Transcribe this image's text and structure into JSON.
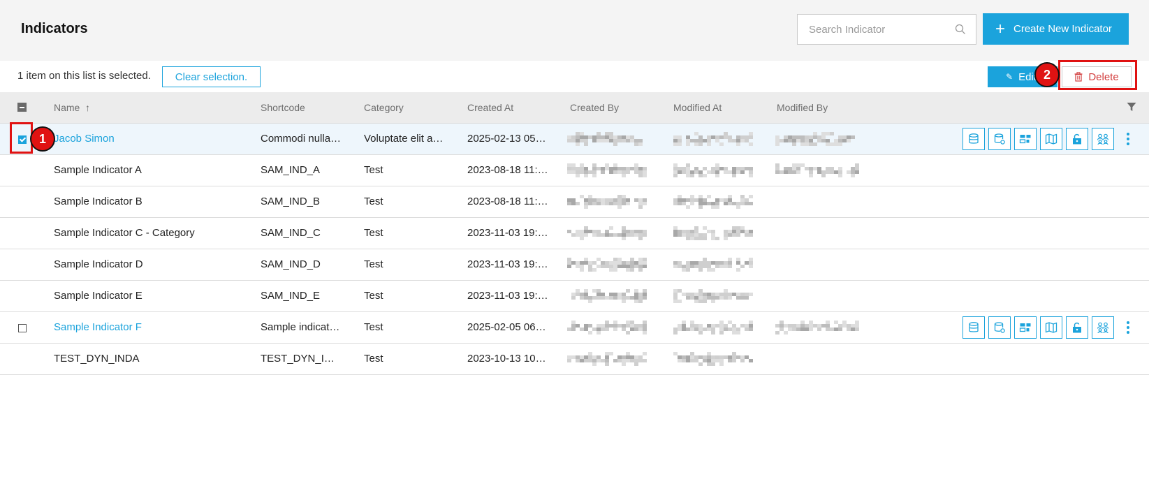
{
  "header": {
    "title": "Indicators",
    "search_placeholder": "Search Indicator",
    "create_label": "Create New Indicator"
  },
  "selection_bar": {
    "text": "1 item on this list is selected.",
    "clear_label": "Clear selection.",
    "edit_label": "Edit",
    "delete_label": "Delete"
  },
  "columns": {
    "name": "Name",
    "shortcode": "Shortcode",
    "category": "Category",
    "created_at": "Created At",
    "created_by": "Created By",
    "modified_at": "Modified At",
    "modified_by": "Modified By"
  },
  "sort": {
    "column": "Name",
    "direction": "ascending"
  },
  "markers": [
    "1",
    "2"
  ],
  "rows": [
    {
      "name": "Jacob Simon",
      "shortcode": "Commodi nulla…",
      "category": "Voluptate elit a…",
      "created_at": "2025-02-13 05…",
      "selected": true,
      "link": true,
      "modified_by_blurred": true,
      "actions": true
    },
    {
      "name": "Sample Indicator A",
      "shortcode": "SAM_IND_A",
      "category": "Test",
      "created_at": "2023-08-18 11:…",
      "selected": false,
      "link": false,
      "modified_by_blurred": true,
      "actions": false
    },
    {
      "name": "Sample Indicator B",
      "shortcode": "SAM_IND_B",
      "category": "Test",
      "created_at": "2023-08-18 11:…",
      "selected": false,
      "link": false,
      "modified_by_blurred": false,
      "actions": false
    },
    {
      "name": "Sample Indicator C - Category",
      "shortcode": "SAM_IND_C",
      "category": "Test",
      "created_at": "2023-11-03 19:…",
      "selected": false,
      "link": false,
      "modified_by_blurred": false,
      "actions": false
    },
    {
      "name": "Sample Indicator D",
      "shortcode": "SAM_IND_D",
      "category": "Test",
      "created_at": "2023-11-03 19:…",
      "selected": false,
      "link": false,
      "modified_by_blurred": false,
      "actions": false
    },
    {
      "name": "Sample Indicator E",
      "shortcode": "SAM_IND_E",
      "category": "Test",
      "created_at": "2023-11-03 19:…",
      "selected": false,
      "link": false,
      "modified_by_blurred": false,
      "actions": false
    },
    {
      "name": "Sample Indicator F",
      "shortcode": "Sample indicat…",
      "category": "Test",
      "created_at": "2025-02-05 06…",
      "selected": false,
      "link": true,
      "modified_by_blurred": true,
      "actions": true,
      "show_checkbox": true
    },
    {
      "name": "TEST_DYN_INDA",
      "shortcode": "TEST_DYN_I…",
      "category": "Test",
      "created_at": "2023-10-13 10…",
      "selected": false,
      "link": false,
      "modified_by_blurred": false,
      "actions": false
    }
  ],
  "row_action_icons": [
    "database-icon",
    "database-settings-icon",
    "blocks-icon",
    "map-icon",
    "unlock-icon",
    "group-icon"
  ],
  "colors": {
    "accent": "#1ba3dc",
    "danger": "#d23c3c",
    "highlight": "#e01212"
  }
}
